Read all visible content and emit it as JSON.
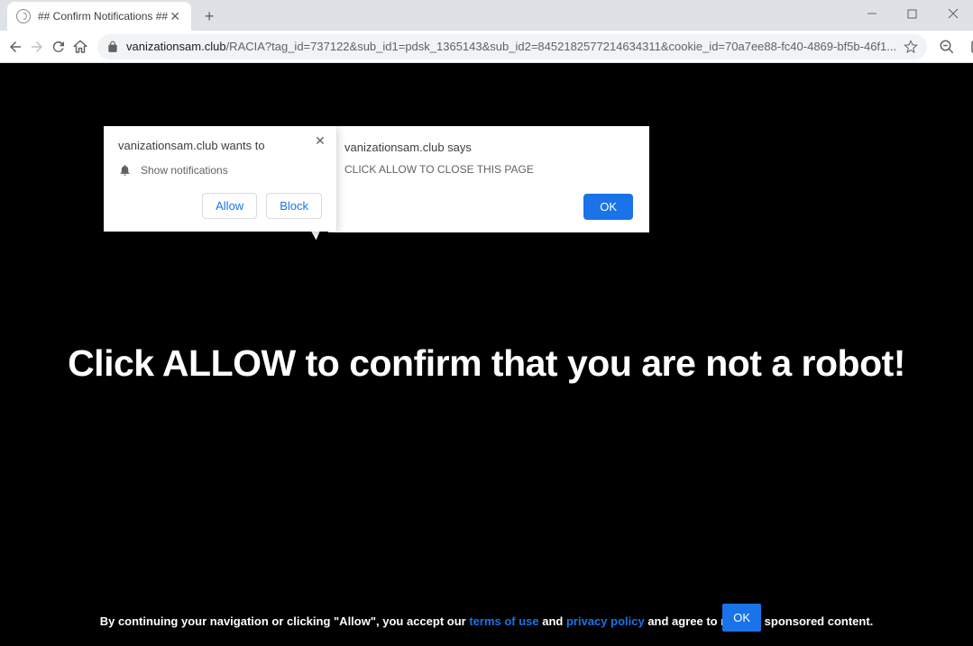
{
  "tab": {
    "title": "## Confirm Notifications ##"
  },
  "url": {
    "domain": "vanizationsam.club",
    "path": "/RACIA?tag_id=737122&sub_id1=pdsk_1365143&sub_id2=8452182577214634311&cookie_id=70a7ee88-fc40-4869-bf5b-46f1..."
  },
  "notif": {
    "title": "vanizationsam.club wants to",
    "permission": "Show notifications",
    "allow": "Allow",
    "block": "Block"
  },
  "alert": {
    "title": "vanizationsam.club says",
    "message": "CLICK ALLOW TO CLOSE THIS PAGE",
    "ok": "OK"
  },
  "page": {
    "headline": "Click ALLOW to confirm that you are not a robot!",
    "footer_pre": "By continuing your navigation or clicking \"Allow\", you accept our ",
    "terms": "terms of use",
    "and": " and ",
    "privacy": "privacy policy",
    "footer_post": " and agree to receive sponsored content.",
    "ok": "OK"
  }
}
